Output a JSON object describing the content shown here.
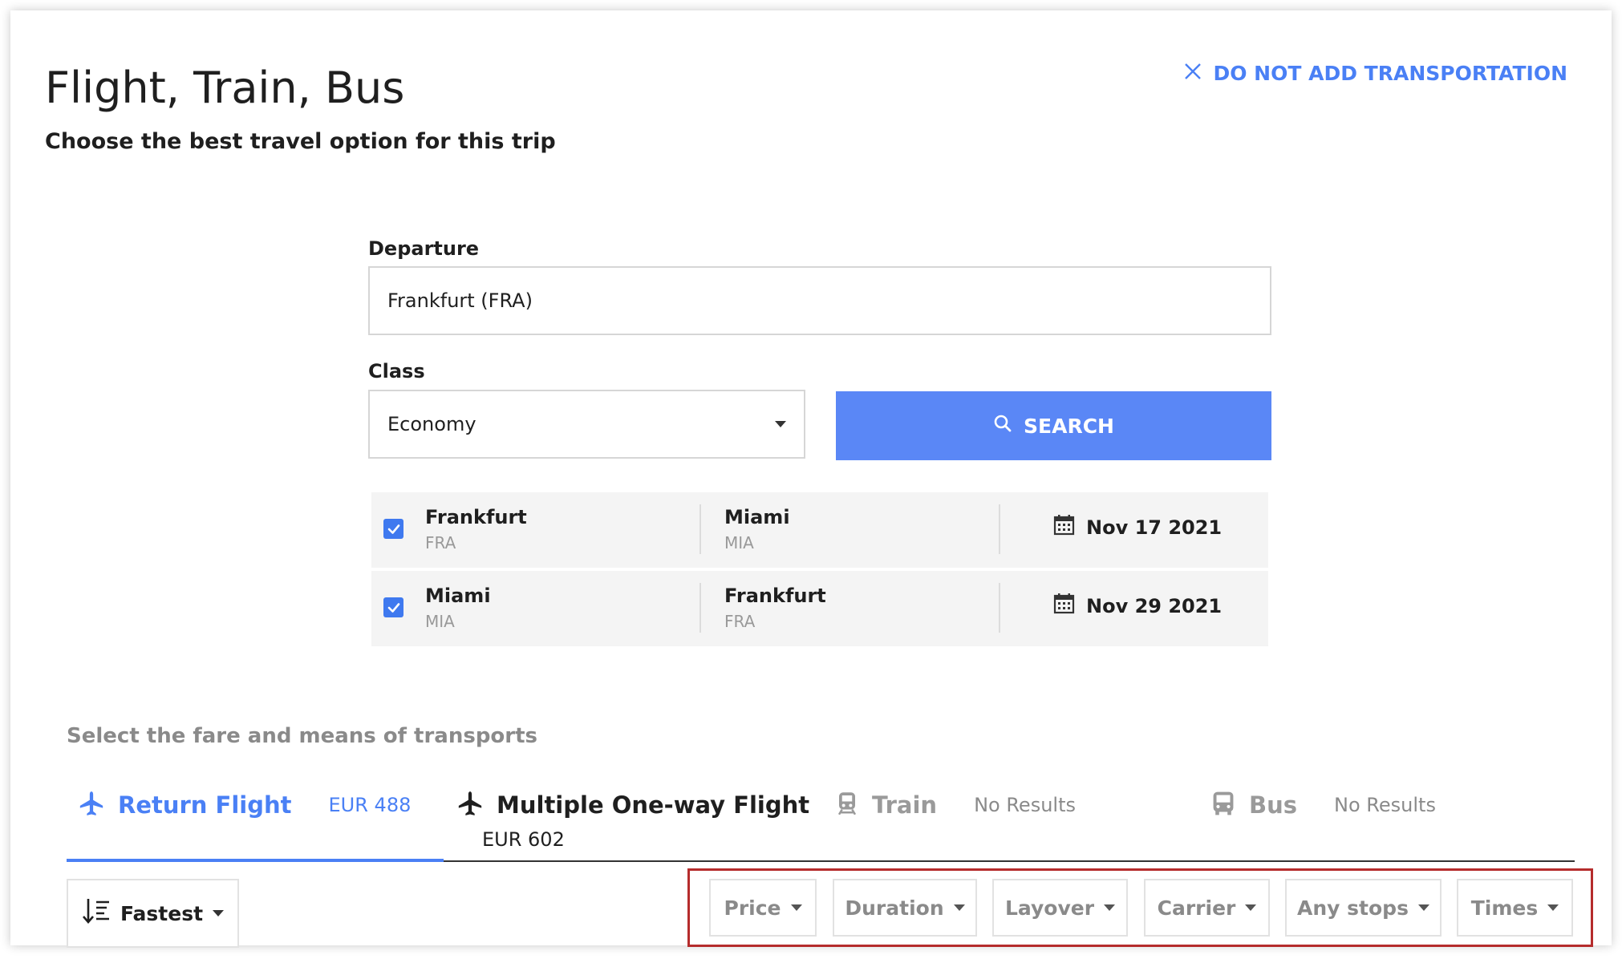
{
  "header": {
    "title": "Flight, Train, Bus",
    "subtitle": "Choose the best travel option for this trip",
    "no_transport_label": "DO NOT ADD TRANSPORTATION"
  },
  "form": {
    "departure_label": "Departure",
    "departure_value": "Frankfurt (FRA)",
    "class_label": "Class",
    "class_value": "Economy",
    "search_label": "SEARCH"
  },
  "routes": [
    {
      "from_city": "Frankfurt",
      "from_code": "FRA",
      "to_city": "Miami",
      "to_code": "MIA",
      "date": "Nov 17 2021",
      "checked": true
    },
    {
      "from_city": "Miami",
      "from_code": "MIA",
      "to_city": "Frankfurt",
      "to_code": "FRA",
      "date": "Nov 29 2021",
      "checked": true
    }
  ],
  "results": {
    "section_label": "Select the fare and means of transports",
    "tabs": [
      {
        "name": "Return Flight",
        "price": "EUR 488",
        "active": true
      },
      {
        "name": "Multiple One-way Flight",
        "price": "EUR 602",
        "active": false
      },
      {
        "name": "Train",
        "price": "No Results",
        "active": false
      },
      {
        "name": "Bus",
        "price": "No Results",
        "active": false
      }
    ],
    "sort_label": "Fastest",
    "filters": [
      "Price",
      "Duration",
      "Layover",
      "Carrier",
      "Any stops",
      "Times"
    ]
  },
  "colors": {
    "accent": "#4a80f5",
    "search_button": "#5a87f6",
    "checkbox": "#3f79ef",
    "highlight_frame": "#b52c2c",
    "muted_text": "#8a8a8a"
  }
}
